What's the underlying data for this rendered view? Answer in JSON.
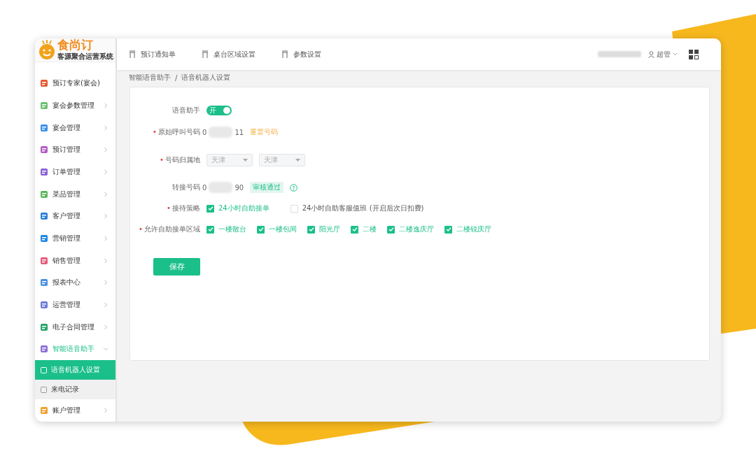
{
  "logo": {
    "name": "食尚订",
    "tagline": "客源聚合运营系统"
  },
  "topnav": [
    {
      "label": "预订通知单"
    },
    {
      "label": "桌台区域设置"
    },
    {
      "label": "参数设置"
    }
  ],
  "user": {
    "name": "超管"
  },
  "sidebar": {
    "items": [
      {
        "label": "预订专家(宴会)",
        "has_children": false,
        "expanded": false
      },
      {
        "label": "宴会参数管理",
        "has_children": true,
        "expanded": false
      },
      {
        "label": "宴会管理",
        "has_children": true,
        "expanded": false
      },
      {
        "label": "预订管理",
        "has_children": true,
        "expanded": false
      },
      {
        "label": "订单管理",
        "has_children": true,
        "expanded": false
      },
      {
        "label": "菜品管理",
        "has_children": true,
        "expanded": false
      },
      {
        "label": "客户管理",
        "has_children": true,
        "expanded": false
      },
      {
        "label": "营销管理",
        "has_children": true,
        "expanded": false
      },
      {
        "label": "销售管理",
        "has_children": true,
        "expanded": false
      },
      {
        "label": "报表中心",
        "has_children": true,
        "expanded": false
      },
      {
        "label": "运营管理",
        "has_children": true,
        "expanded": false
      },
      {
        "label": "电子合同管理",
        "has_children": true,
        "expanded": false
      },
      {
        "label": "智能语音助手",
        "has_children": true,
        "expanded": true,
        "children": [
          {
            "label": "语音机器人设置",
            "selected": true
          },
          {
            "label": "来电记录",
            "selected": false
          }
        ]
      },
      {
        "label": "账户管理",
        "has_children": true,
        "expanded": false
      }
    ]
  },
  "breadcrumb": {
    "items": [
      "智能语音助手",
      "语音机器人设置"
    ],
    "separator": "/"
  },
  "form": {
    "required_mark": "•",
    "assistant": {
      "label": "语音助手",
      "on": true,
      "switch_text": "开"
    },
    "original_number": {
      "label": "原始呼叫号码",
      "required": true,
      "start": "0",
      "end": "11",
      "action": "重置号码"
    },
    "region": {
      "label": "号码归属地",
      "required": true,
      "selects": [
        {
          "value": "天津"
        },
        {
          "value": "天津"
        }
      ]
    },
    "transfer": {
      "label": "转接号码",
      "required": false,
      "start": "0",
      "end": "90",
      "badge": "审核通过"
    },
    "strategy": {
      "label": "接待策略",
      "required": true,
      "options": [
        {
          "label": "24小时自助接单",
          "checked": true
        },
        {
          "label": "24小时自助客服值班 (开启后次日扣费)",
          "checked": false
        }
      ]
    },
    "areas": {
      "label": "允许自助接单区域",
      "required": true,
      "options": [
        {
          "label": "一楼散台",
          "checked": true
        },
        {
          "label": "一楼包间",
          "checked": true
        },
        {
          "label": "阳光厅",
          "checked": true
        },
        {
          "label": "二楼",
          "checked": true
        },
        {
          "label": "二楼逸庆厅",
          "checked": true
        },
        {
          "label": "二楼锐庆厅",
          "checked": true
        }
      ]
    },
    "save": "保存"
  }
}
